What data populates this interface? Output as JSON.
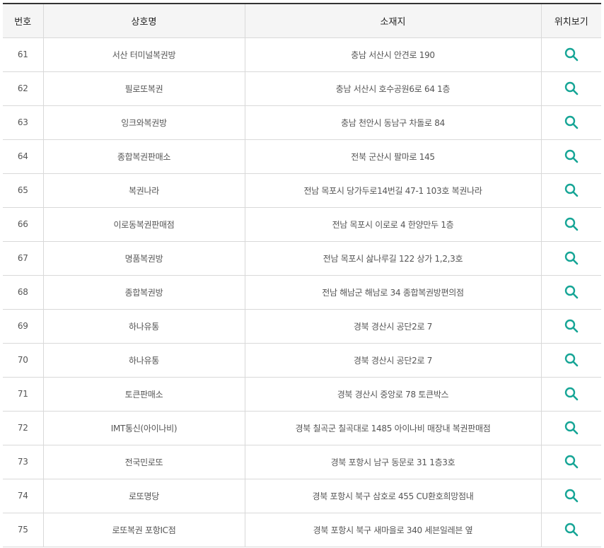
{
  "header": {
    "no": "번호",
    "name": "상호명",
    "address": "소재지",
    "map": "위치보기"
  },
  "accent_color": "#16a596",
  "icons": {
    "map": "search-icon"
  },
  "rows": [
    {
      "no": "61",
      "name": "서산 터미널복권방",
      "address": "충남 서산시 안견로 190"
    },
    {
      "no": "62",
      "name": "필로또복권",
      "address": "충남 서산시 호수공원6로 64 1층"
    },
    {
      "no": "63",
      "name": "잉크와복권방",
      "address": "충남 천안시 동남구 차돌로 84"
    },
    {
      "no": "64",
      "name": "종합복권판매소",
      "address": "전북 군산시 팔마로 145"
    },
    {
      "no": "65",
      "name": "복권나라",
      "address": "전남 목포시 당가두로14번길 47-1 103호 복권나라"
    },
    {
      "no": "66",
      "name": "이로동복권판매점",
      "address": "전남 목포시 이로로 4 한양만두 1층"
    },
    {
      "no": "67",
      "name": "명품복권방",
      "address": "전남 목포시 삺나루길 122 상가 1,2,3호"
    },
    {
      "no": "68",
      "name": "종합복권방",
      "address": "전남 해남군 해남로 34 종합복권방편의점"
    },
    {
      "no": "69",
      "name": "하나유통",
      "address": "경북 경산시 공단2로 7"
    },
    {
      "no": "70",
      "name": "하나유통",
      "address": "경북 경산시 공단2로 7"
    },
    {
      "no": "71",
      "name": "토큰판매소",
      "address": "경북 경산시 중앙로 78 토큰박스"
    },
    {
      "no": "72",
      "name": "IMT통신(아이나비)",
      "address": "경북 칠곡군 칠곡대로 1485 아이나비 매장내 복권판매점"
    },
    {
      "no": "73",
      "name": "전국민로또",
      "address": "경북 포항시 남구 동문로 31 1층3호"
    },
    {
      "no": "74",
      "name": "로또명당",
      "address": "경북 포항시 북구 삼호로 455 CU환호희망점내"
    },
    {
      "no": "75",
      "name": "로또복권 포항IC점",
      "address": "경북 포항시 북구 새마을로 340 세븐일레븐 옆"
    }
  ]
}
